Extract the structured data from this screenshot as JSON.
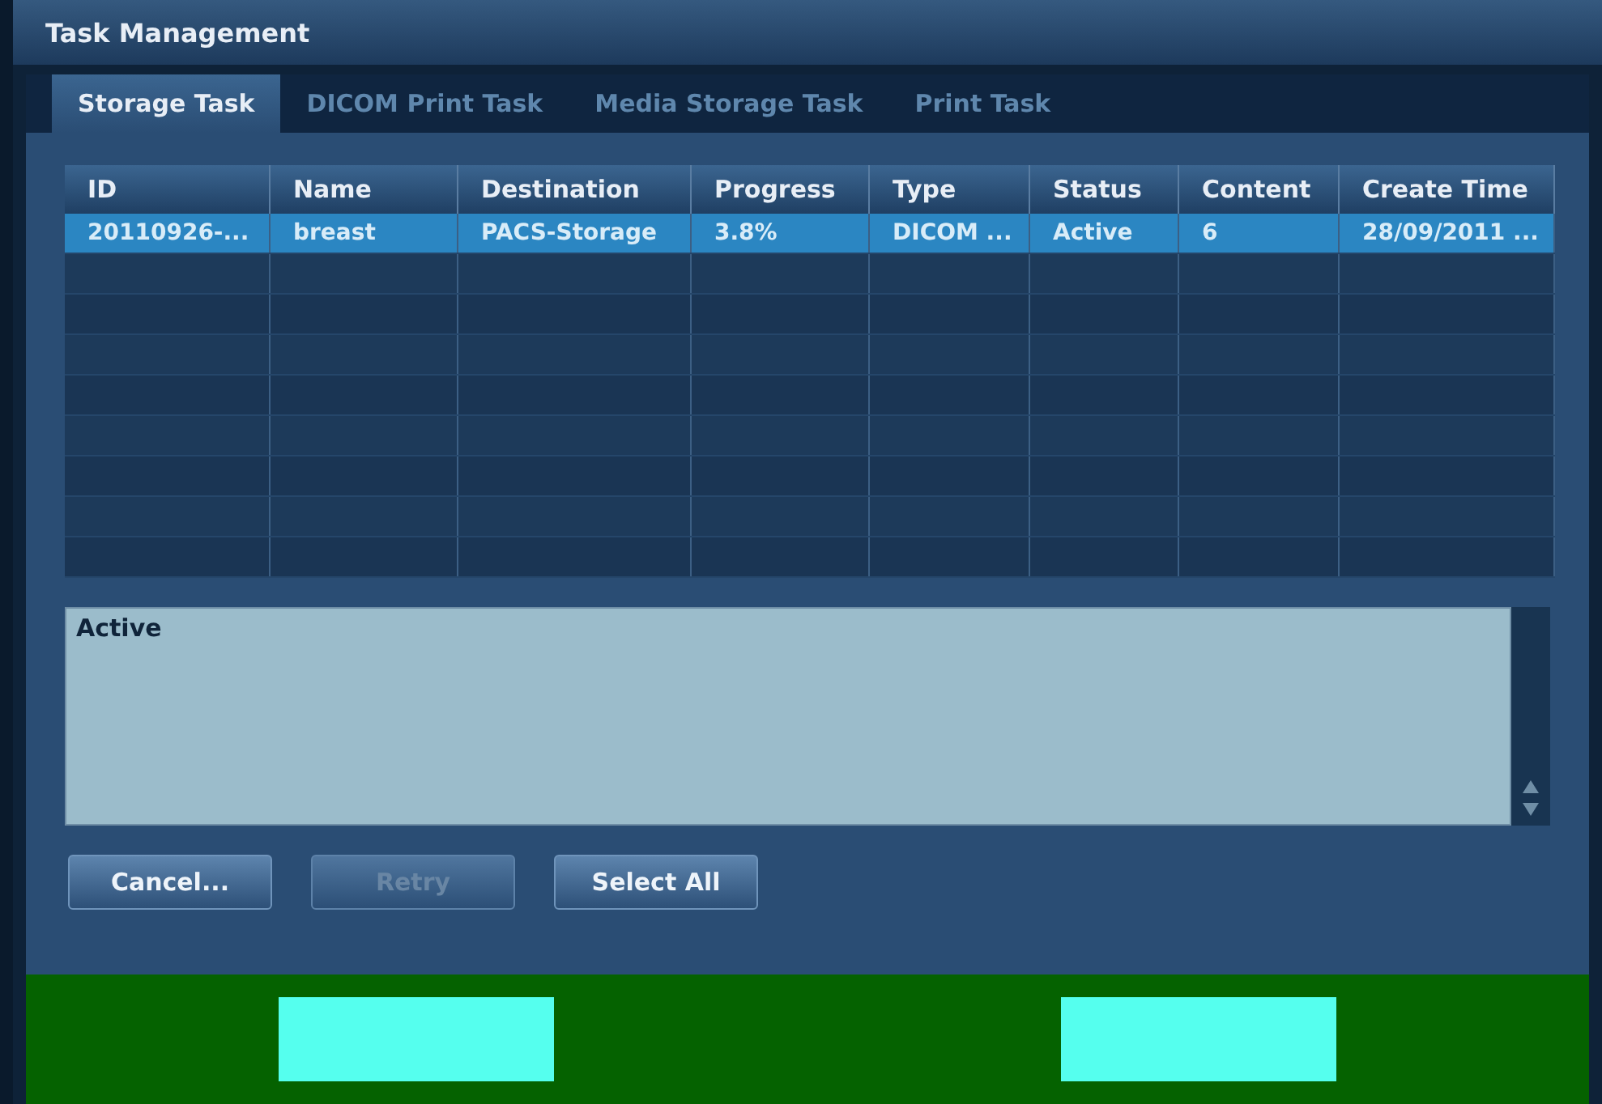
{
  "window": {
    "title": "Task Management"
  },
  "tabs": [
    {
      "label": "Storage Task",
      "selected": true
    },
    {
      "label": "DICOM Print Task",
      "selected": false
    },
    {
      "label": "Media Storage Task",
      "selected": false
    },
    {
      "label": "Print Task",
      "selected": false
    }
  ],
  "table": {
    "columns": [
      "ID",
      "Name",
      "Destination",
      "Progress",
      "Type",
      "Status",
      "Content",
      "Create Time"
    ],
    "rows": [
      {
        "selected": true,
        "cells": [
          "20110926-...",
          "breast",
          "PACS-Storage",
          "3.8%",
          "DICOM ...",
          "Active",
          "6",
          "28/09/2011 ..."
        ]
      }
    ]
  },
  "detail": {
    "text": "Active"
  },
  "buttons": [
    {
      "label": "Cancel...",
      "disabled": false
    },
    {
      "label": "Retry",
      "disabled": true
    },
    {
      "label": "Select All",
      "disabled": false
    }
  ]
}
